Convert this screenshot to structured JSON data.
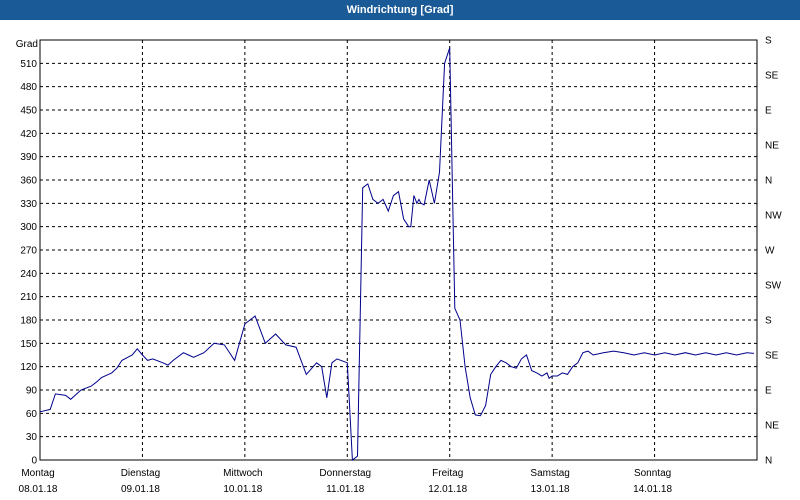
{
  "window": {
    "title": "Windrichtung [Grad]"
  },
  "chart_data": {
    "type": "line",
    "title": "Windrichtung [Grad]",
    "ylabel": "Grad",
    "ylim": [
      0,
      540
    ],
    "y_ticks": [
      0,
      30,
      60,
      90,
      120,
      150,
      180,
      210,
      240,
      270,
      300,
      330,
      360,
      390,
      420,
      450,
      480,
      510
    ],
    "right_ticks": [
      {
        "value": 0,
        "label": "N"
      },
      {
        "value": 45,
        "label": "NE"
      },
      {
        "value": 90,
        "label": "E"
      },
      {
        "value": 135,
        "label": "SE"
      },
      {
        "value": 180,
        "label": "S"
      },
      {
        "value": 225,
        "label": "SW"
      },
      {
        "value": 270,
        "label": "W"
      },
      {
        "value": 315,
        "label": "NW"
      },
      {
        "value": 360,
        "label": "N"
      },
      {
        "value": 405,
        "label": "NE"
      },
      {
        "value": 450,
        "label": "E"
      },
      {
        "value": 495,
        "label": "SE"
      },
      {
        "value": 540,
        "label": "S"
      }
    ],
    "xlim": [
      0,
      7
    ],
    "x_ticks": [
      {
        "value": 0,
        "day": "Montag",
        "date": "08.01.18"
      },
      {
        "value": 1,
        "day": "Dienstag",
        "date": "09.01.18"
      },
      {
        "value": 2,
        "day": "Mittwoch",
        "date": "10.01.18"
      },
      {
        "value": 3,
        "day": "Donnerstag",
        "date": "11.01.18"
      },
      {
        "value": 4,
        "day": "Freitag",
        "date": "12.01.18"
      },
      {
        "value": 5,
        "day": "Samstag",
        "date": "13.01.18"
      },
      {
        "value": 6,
        "day": "Sonntag",
        "date": "14.01.18"
      }
    ],
    "grid": true,
    "color": "#00008b",
    "series": [
      {
        "x": [
          0,
          0.1,
          0.15,
          0.25,
          0.3,
          0.4,
          0.5,
          0.55,
          0.6,
          0.7,
          0.75,
          0.8,
          0.9,
          0.95,
          1.0,
          1.05,
          1.1,
          1.2,
          1.25,
          1.3,
          1.4,
          1.45,
          1.5,
          1.6,
          1.7,
          1.8,
          1.9,
          2.0,
          2.1,
          2.2,
          2.3,
          2.4,
          2.5,
          2.6,
          2.7,
          2.75,
          2.8,
          2.85,
          2.9,
          3.0,
          3.05,
          3.1,
          3.15,
          3.2,
          3.25,
          3.3,
          3.35,
          3.4,
          3.45,
          3.5,
          3.55,
          3.6,
          3.62,
          3.65,
          3.68,
          3.7,
          3.72,
          3.75,
          3.8,
          3.85,
          3.9,
          3.95,
          4.0,
          4.05,
          4.1,
          4.15,
          4.2,
          4.25,
          4.3,
          4.35,
          4.4,
          4.45,
          4.5,
          4.55,
          4.6,
          4.65,
          4.7,
          4.75,
          4.8,
          4.85,
          4.9,
          4.95,
          4.97,
          5.0,
          5.05,
          5.1,
          5.15,
          5.2,
          5.25,
          5.3,
          5.35,
          5.4,
          5.5,
          5.6,
          5.7,
          5.8,
          5.9,
          6.0,
          6.1,
          6.2,
          6.3,
          6.4,
          6.5,
          6.6,
          6.7,
          6.8,
          6.9,
          6.97
        ],
        "values": [
          62,
          65,
          85,
          83,
          78,
          90,
          95,
          100,
          106,
          112,
          118,
          128,
          135,
          143,
          135,
          128,
          130,
          125,
          122,
          128,
          138,
          135,
          132,
          138,
          150,
          148,
          128,
          175,
          185,
          150,
          162,
          148,
          145,
          110,
          125,
          120,
          80,
          125,
          130,
          125,
          0,
          5,
          350,
          355,
          335,
          330,
          335,
          320,
          340,
          345,
          310,
          300,
          300,
          340,
          330,
          335,
          330,
          328,
          360,
          330,
          370,
          510,
          530,
          195,
          180,
          120,
          80,
          58,
          57,
          70,
          110,
          120,
          128,
          125,
          120,
          118,
          130,
          135,
          115,
          112,
          108,
          112,
          105,
          108,
          108,
          112,
          110,
          120,
          125,
          138,
          140,
          135,
          138,
          140,
          138,
          135,
          138,
          135,
          138,
          135,
          138,
          135,
          138,
          135,
          138,
          135,
          138,
          137
        ]
      }
    ]
  }
}
